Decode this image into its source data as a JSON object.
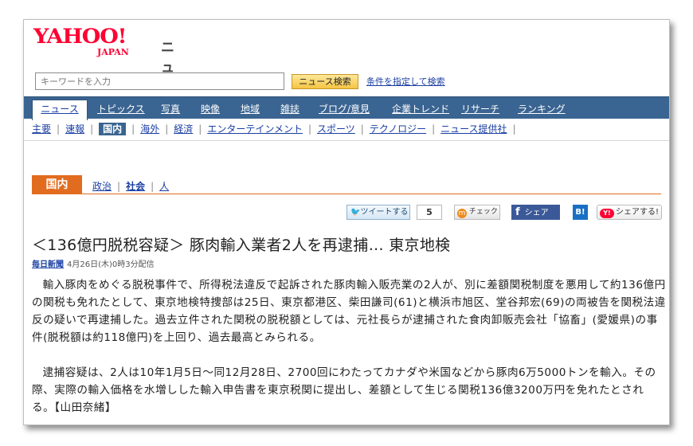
{
  "header": {
    "logo_main": "YAHOO!",
    "logo_sub": "JAPAN",
    "service": "ニュース"
  },
  "search": {
    "placeholder": "キーワードを入力",
    "button": "ニュース検索",
    "advanced": "条件を指定して検索"
  },
  "nav": {
    "tabs": [
      "ニュース",
      "トピックス",
      "写真",
      "映像",
      "地域",
      "雑誌",
      "ブログ/意見",
      "企業トレンド",
      "リサーチ",
      "ランキング"
    ],
    "sub": [
      "主要",
      "速報",
      "国内",
      "海外",
      "経済",
      "エンターテインメント",
      "スポーツ",
      "テクノロジー",
      "ニュース提供社"
    ]
  },
  "category": {
    "label": "国内",
    "links": [
      "政治",
      "社会",
      "人"
    ]
  },
  "share": {
    "tweet": "ツイートする",
    "tweet_count": "5",
    "check": "チェック",
    "check_icon": "m",
    "facebook": "シェア",
    "facebook_icon": "f",
    "hatena": "B!",
    "yahoo_share": "シェアする!",
    "yahoo_icon": "Y!"
  },
  "article": {
    "title": "＜136億円脱税容疑＞ 豚肉輸入業者2人を再逮捕… 東京地検",
    "source": "毎日新聞",
    "date": "4月26日(木)0時3分配信",
    "paragraphs": [
      "輸入豚肉をめぐる脱税事件で、所得税法違反で起訴された豚肉輸入販売業の2人が、別に差額関税制度を悪用して約136億円の関税も免れたとして、東京地検特捜部は25日、東京都港区、柴田謙司(61)と横浜市旭区、堂谷邦宏(69)の両被告を関税法違反の疑いで再逮捕した。過去立件された関税の脱税額としては、元社長らが逮捕された食肉卸販売会社「協畜」(愛媛県)の事件(脱税額は約118億円)を上回り、過去最高とみられる。",
      "逮捕容疑は、2人は10年1月5日～同12月28日、2700回にわたってカナダや米国などから豚肉6万5000トンを輸入。その際、実際の輸入価格を水増しした輸入申告書を東京税関に提出し、差額として生じる関税136億3200万円を免れたとされる。【山田奈緒】"
    ]
  },
  "colors": {
    "nav_bg": "#3a6491",
    "category": "#e16c1f",
    "logo": "#ff0033",
    "link": "#1a3fa3"
  }
}
